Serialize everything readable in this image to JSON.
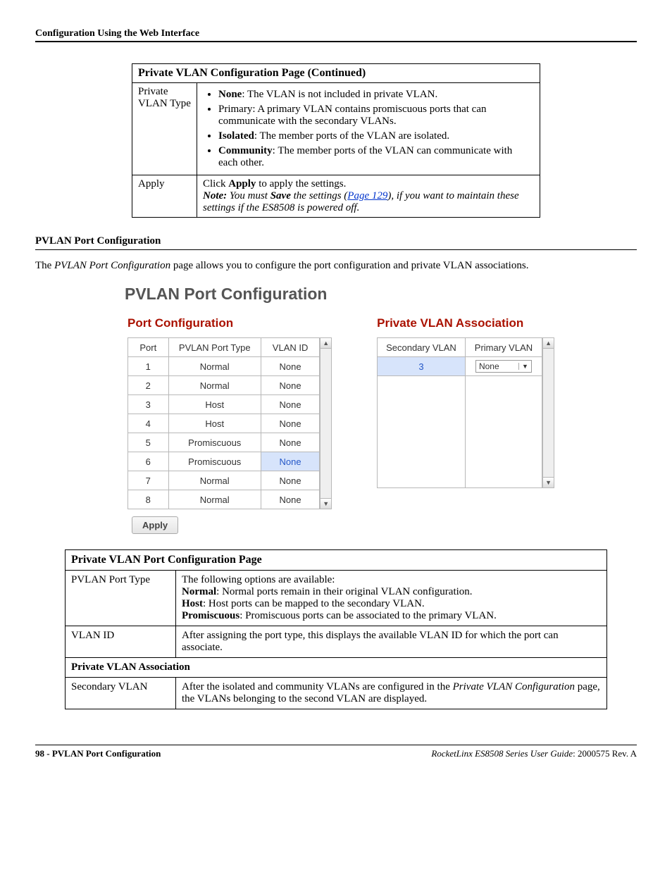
{
  "header": {
    "section_title": "Configuration Using the Web Interface"
  },
  "table1": {
    "title": "Private VLAN Configuration Page  (Continued)",
    "row1_label": "Private VLAN Type",
    "row1_items": {
      "none_bold": "None",
      "none_text": ": The VLAN is not included in private VLAN.",
      "primary": "Primary: A primary VLAN contains promiscuous ports that can communicate with the secondary VLANs.",
      "isolated_bold": "Isolated",
      "isolated_text": ": The member ports of the VLAN are isolated.",
      "community_bold": "Community",
      "community_text": ": The member ports of the VLAN can communicate with each other."
    },
    "row2_label": "Apply",
    "row2_line1_a": "Click ",
    "row2_line1_b": "Apply",
    "row2_line1_c": " to apply the settings.",
    "row2_note_bold1": "Note:",
    "row2_note_mid1": "  You must ",
    "row2_note_bold2": "Save",
    "row2_note_mid2": " the settings (",
    "row2_note_link": "Page 129",
    "row2_note_mid3": "), if you want to maintain these settings if the ES8508 is powered off."
  },
  "section2": {
    "heading": "PVLAN Port Configuration",
    "para_a": "The ",
    "para_i": "PVLAN Port Configuration",
    "para_b": " page allows you to configure the port configuration and private VLAN associations."
  },
  "screenshot": {
    "title": "PVLAN Port Configuration",
    "left_heading": "Port Configuration",
    "right_heading": "Private VLAN Association",
    "cols_left": {
      "c1": "Port",
      "c2": "PVLAN Port Type",
      "c3": "VLAN ID"
    },
    "rows_left": [
      {
        "port": "1",
        "type": "Normal",
        "vid": "None"
      },
      {
        "port": "2",
        "type": "Normal",
        "vid": "None"
      },
      {
        "port": "3",
        "type": "Host",
        "vid": "None"
      },
      {
        "port": "4",
        "type": "Host",
        "vid": "None"
      },
      {
        "port": "5",
        "type": "Promiscuous",
        "vid": "None"
      },
      {
        "port": "6",
        "type": "Promiscuous",
        "vid": "None"
      },
      {
        "port": "7",
        "type": "Normal",
        "vid": "None"
      },
      {
        "port": "8",
        "type": "Normal",
        "vid": "None"
      }
    ],
    "cols_right": {
      "c1": "Secondary VLAN",
      "c2": "Primary VLAN"
    },
    "right_row": {
      "sec": "3",
      "prim": "None"
    },
    "apply_btn": "Apply"
  },
  "table2": {
    "title": "Private VLAN Port Configuration Page",
    "r1_label": "PVLAN Port Type",
    "r1_intro": "The following options are available:",
    "r1_normal_b": "Normal",
    "r1_normal_t": ": Normal ports remain in their original VLAN configuration.",
    "r1_host_b": "Host",
    "r1_host_t": ": Host ports can be mapped to the secondary VLAN.",
    "r1_prom_b": "Promiscuous",
    "r1_prom_t": ": Promiscuous ports can be associated to the primary VLAN.",
    "r2_label": "VLAN ID",
    "r2_text": "After assigning the port type, this displays the available VLAN ID for which the port can associate.",
    "r3_span": "Private VLAN Association",
    "r4_label": "Secondary VLAN",
    "r4_text_a": "After the isolated and community VLANs are configured in the ",
    "r4_text_i": "Private VLAN Configuration",
    "r4_text_b": " page, the VLANs belonging to the second VLAN are displayed."
  },
  "footer": {
    "left": "98 - PVLAN Port Configuration",
    "right_i": "RocketLinx ES8508 Series  User Guide",
    "right_n": ": 2000575 Rev. A"
  }
}
